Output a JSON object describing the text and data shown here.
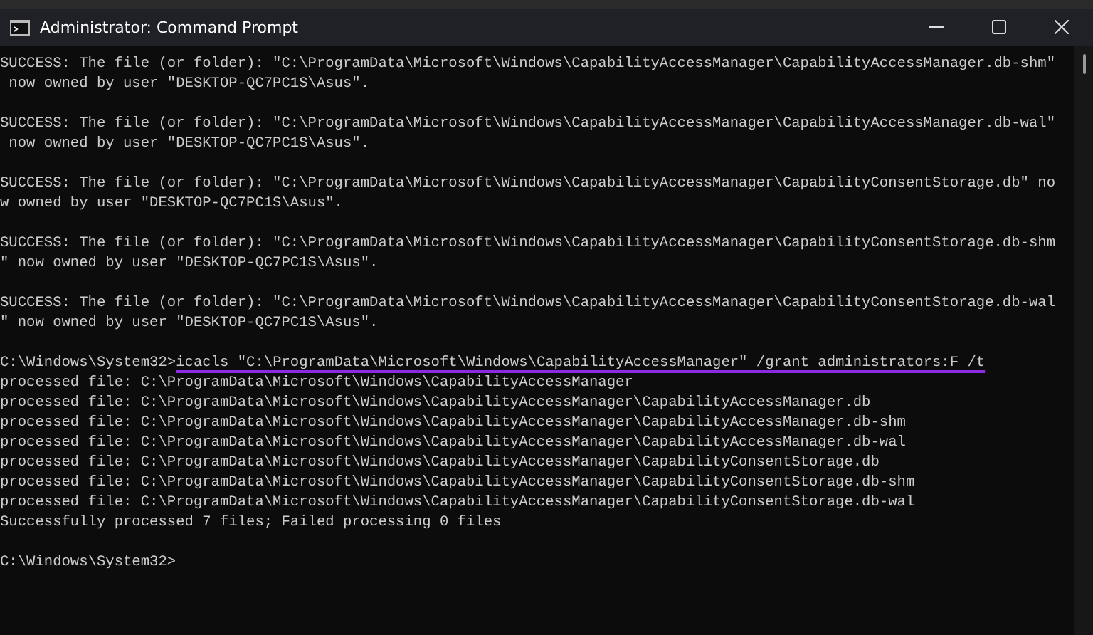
{
  "window": {
    "title": "Administrator: Command Prompt"
  },
  "console": {
    "lines": [
      {
        "kind": "output",
        "text": "SUCCESS: The file (or folder): \"C:\\ProgramData\\Microsoft\\Windows\\CapabilityAccessManager\\CapabilityAccessManager.db-shm\""
      },
      {
        "kind": "output",
        "text": " now owned by user \"DESKTOP-QC7PC1S\\Asus\"."
      },
      {
        "kind": "blank"
      },
      {
        "kind": "output",
        "text": "SUCCESS: The file (or folder): \"C:\\ProgramData\\Microsoft\\Windows\\CapabilityAccessManager\\CapabilityAccessManager.db-wal\""
      },
      {
        "kind": "output",
        "text": " now owned by user \"DESKTOP-QC7PC1S\\Asus\"."
      },
      {
        "kind": "blank"
      },
      {
        "kind": "output",
        "text": "SUCCESS: The file (or folder): \"C:\\ProgramData\\Microsoft\\Windows\\CapabilityAccessManager\\CapabilityConsentStorage.db\" no"
      },
      {
        "kind": "output",
        "text": "w owned by user \"DESKTOP-QC7PC1S\\Asus\"."
      },
      {
        "kind": "blank"
      },
      {
        "kind": "output",
        "text": "SUCCESS: The file (or folder): \"C:\\ProgramData\\Microsoft\\Windows\\CapabilityAccessManager\\CapabilityConsentStorage.db-shm"
      },
      {
        "kind": "output",
        "text": "\" now owned by user \"DESKTOP-QC7PC1S\\Asus\"."
      },
      {
        "kind": "blank"
      },
      {
        "kind": "output",
        "text": "SUCCESS: The file (or folder): \"C:\\ProgramData\\Microsoft\\Windows\\CapabilityAccessManager\\CapabilityConsentStorage.db-wal"
      },
      {
        "kind": "output",
        "text": "\" now owned by user \"DESKTOP-QC7PC1S\\Asus\"."
      },
      {
        "kind": "blank"
      },
      {
        "kind": "command",
        "prompt": "C:\\Windows\\System32>",
        "text": "icacls \"C:\\ProgramData\\Microsoft\\Windows\\CapabilityAccessManager\" /grant administrators:F /t",
        "underlined": true
      },
      {
        "kind": "output",
        "text": "processed file: C:\\ProgramData\\Microsoft\\Windows\\CapabilityAccessManager"
      },
      {
        "kind": "output",
        "text": "processed file: C:\\ProgramData\\Microsoft\\Windows\\CapabilityAccessManager\\CapabilityAccessManager.db"
      },
      {
        "kind": "output",
        "text": "processed file: C:\\ProgramData\\Microsoft\\Windows\\CapabilityAccessManager\\CapabilityAccessManager.db-shm"
      },
      {
        "kind": "output",
        "text": "processed file: C:\\ProgramData\\Microsoft\\Windows\\CapabilityAccessManager\\CapabilityAccessManager.db-wal"
      },
      {
        "kind": "output",
        "text": "processed file: C:\\ProgramData\\Microsoft\\Windows\\CapabilityAccessManager\\CapabilityConsentStorage.db"
      },
      {
        "kind": "output",
        "text": "processed file: C:\\ProgramData\\Microsoft\\Windows\\CapabilityAccessManager\\CapabilityConsentStorage.db-shm"
      },
      {
        "kind": "output",
        "text": "processed file: C:\\ProgramData\\Microsoft\\Windows\\CapabilityAccessManager\\CapabilityConsentStorage.db-wal"
      },
      {
        "kind": "output",
        "text": "Successfully processed 7 files; Failed processing 0 files"
      },
      {
        "kind": "blank"
      },
      {
        "kind": "command",
        "prompt": "C:\\Windows\\System32>"
      }
    ]
  }
}
